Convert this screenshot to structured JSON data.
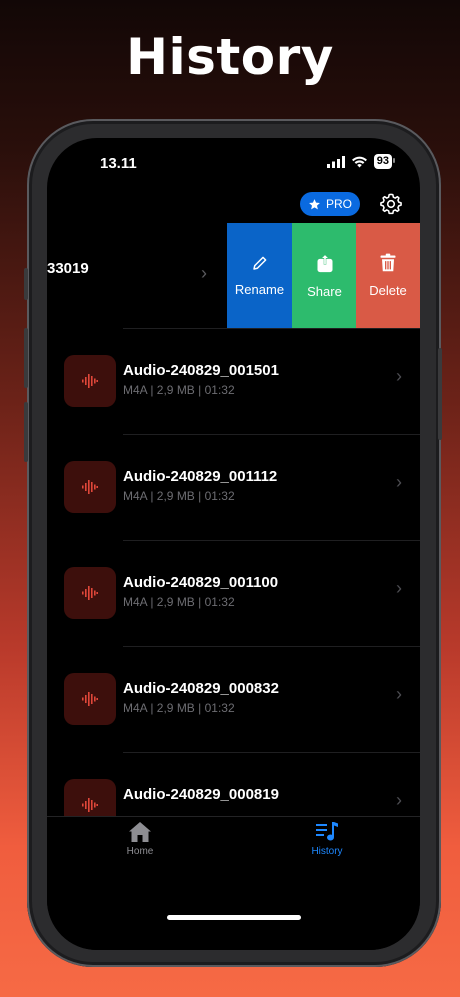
{
  "headline": "History",
  "status_bar": {
    "time": "13.11",
    "battery": "93"
  },
  "header": {
    "pro_label": "PRO"
  },
  "swiped_item": {
    "title_fragment": "33019",
    "actions": {
      "rename": "Rename",
      "share": "Share",
      "delete": "Delete"
    }
  },
  "recordings": [
    {
      "title": "Audio-240829_001501",
      "meta": "M4A | 2,9 MB | 01:32"
    },
    {
      "title": "Audio-240829_001112",
      "meta": "M4A | 2,9 MB | 01:32"
    },
    {
      "title": "Audio-240829_001100",
      "meta": "M4A | 2,9 MB | 01:32"
    },
    {
      "title": "Audio-240829_000832",
      "meta": "M4A | 2,9 MB | 01:32"
    },
    {
      "title": "Audio-240829_000819",
      "meta": ""
    }
  ],
  "tabbar": {
    "home": "Home",
    "history": "History"
  },
  "colors": {
    "accent": "#0a6ae0",
    "rename": "#0a64c8",
    "share": "#2dbb6d",
    "delete": "#d95a46",
    "waveform": "#e0473a"
  },
  "icons": [
    "star-icon",
    "gear-icon",
    "pencil-icon",
    "share-icon",
    "trash-icon",
    "waveform-icon",
    "chevron-right-icon",
    "house-icon",
    "music-list-icon"
  ]
}
